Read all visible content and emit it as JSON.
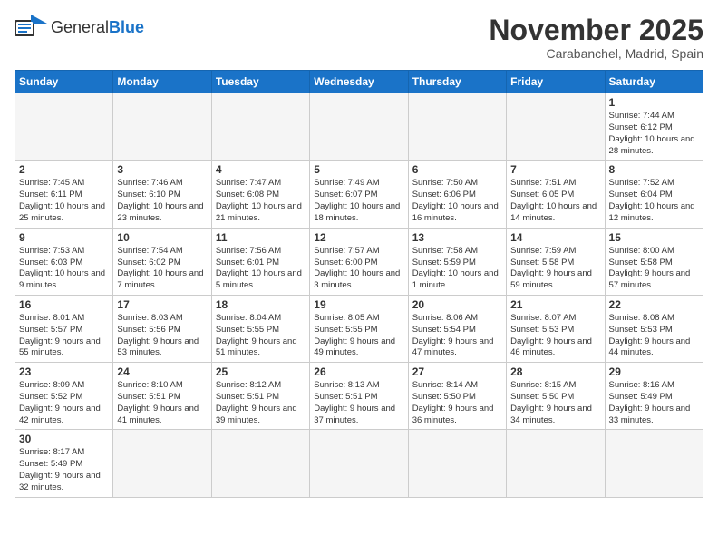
{
  "header": {
    "logo_general": "General",
    "logo_blue": "Blue",
    "month_title": "November 2025",
    "location": "Carabanchel, Madrid, Spain"
  },
  "days_of_week": [
    "Sunday",
    "Monday",
    "Tuesday",
    "Wednesday",
    "Thursday",
    "Friday",
    "Saturday"
  ],
  "weeks": [
    [
      {
        "day": "",
        "info": ""
      },
      {
        "day": "",
        "info": ""
      },
      {
        "day": "",
        "info": ""
      },
      {
        "day": "",
        "info": ""
      },
      {
        "day": "",
        "info": ""
      },
      {
        "day": "",
        "info": ""
      },
      {
        "day": "1",
        "info": "Sunrise: 7:44 AM\nSunset: 6:12 PM\nDaylight: 10 hours and 28 minutes."
      }
    ],
    [
      {
        "day": "2",
        "info": "Sunrise: 7:45 AM\nSunset: 6:11 PM\nDaylight: 10 hours and 25 minutes."
      },
      {
        "day": "3",
        "info": "Sunrise: 7:46 AM\nSunset: 6:10 PM\nDaylight: 10 hours and 23 minutes."
      },
      {
        "day": "4",
        "info": "Sunrise: 7:47 AM\nSunset: 6:08 PM\nDaylight: 10 hours and 21 minutes."
      },
      {
        "day": "5",
        "info": "Sunrise: 7:49 AM\nSunset: 6:07 PM\nDaylight: 10 hours and 18 minutes."
      },
      {
        "day": "6",
        "info": "Sunrise: 7:50 AM\nSunset: 6:06 PM\nDaylight: 10 hours and 16 minutes."
      },
      {
        "day": "7",
        "info": "Sunrise: 7:51 AM\nSunset: 6:05 PM\nDaylight: 10 hours and 14 minutes."
      },
      {
        "day": "8",
        "info": "Sunrise: 7:52 AM\nSunset: 6:04 PM\nDaylight: 10 hours and 12 minutes."
      }
    ],
    [
      {
        "day": "9",
        "info": "Sunrise: 7:53 AM\nSunset: 6:03 PM\nDaylight: 10 hours and 9 minutes."
      },
      {
        "day": "10",
        "info": "Sunrise: 7:54 AM\nSunset: 6:02 PM\nDaylight: 10 hours and 7 minutes."
      },
      {
        "day": "11",
        "info": "Sunrise: 7:56 AM\nSunset: 6:01 PM\nDaylight: 10 hours and 5 minutes."
      },
      {
        "day": "12",
        "info": "Sunrise: 7:57 AM\nSunset: 6:00 PM\nDaylight: 10 hours and 3 minutes."
      },
      {
        "day": "13",
        "info": "Sunrise: 7:58 AM\nSunset: 5:59 PM\nDaylight: 10 hours and 1 minute."
      },
      {
        "day": "14",
        "info": "Sunrise: 7:59 AM\nSunset: 5:58 PM\nDaylight: 9 hours and 59 minutes."
      },
      {
        "day": "15",
        "info": "Sunrise: 8:00 AM\nSunset: 5:58 PM\nDaylight: 9 hours and 57 minutes."
      }
    ],
    [
      {
        "day": "16",
        "info": "Sunrise: 8:01 AM\nSunset: 5:57 PM\nDaylight: 9 hours and 55 minutes."
      },
      {
        "day": "17",
        "info": "Sunrise: 8:03 AM\nSunset: 5:56 PM\nDaylight: 9 hours and 53 minutes."
      },
      {
        "day": "18",
        "info": "Sunrise: 8:04 AM\nSunset: 5:55 PM\nDaylight: 9 hours and 51 minutes."
      },
      {
        "day": "19",
        "info": "Sunrise: 8:05 AM\nSunset: 5:55 PM\nDaylight: 9 hours and 49 minutes."
      },
      {
        "day": "20",
        "info": "Sunrise: 8:06 AM\nSunset: 5:54 PM\nDaylight: 9 hours and 47 minutes."
      },
      {
        "day": "21",
        "info": "Sunrise: 8:07 AM\nSunset: 5:53 PM\nDaylight: 9 hours and 46 minutes."
      },
      {
        "day": "22",
        "info": "Sunrise: 8:08 AM\nSunset: 5:53 PM\nDaylight: 9 hours and 44 minutes."
      }
    ],
    [
      {
        "day": "23",
        "info": "Sunrise: 8:09 AM\nSunset: 5:52 PM\nDaylight: 9 hours and 42 minutes."
      },
      {
        "day": "24",
        "info": "Sunrise: 8:10 AM\nSunset: 5:51 PM\nDaylight: 9 hours and 41 minutes."
      },
      {
        "day": "25",
        "info": "Sunrise: 8:12 AM\nSunset: 5:51 PM\nDaylight: 9 hours and 39 minutes."
      },
      {
        "day": "26",
        "info": "Sunrise: 8:13 AM\nSunset: 5:51 PM\nDaylight: 9 hours and 37 minutes."
      },
      {
        "day": "27",
        "info": "Sunrise: 8:14 AM\nSunset: 5:50 PM\nDaylight: 9 hours and 36 minutes."
      },
      {
        "day": "28",
        "info": "Sunrise: 8:15 AM\nSunset: 5:50 PM\nDaylight: 9 hours and 34 minutes."
      },
      {
        "day": "29",
        "info": "Sunrise: 8:16 AM\nSunset: 5:49 PM\nDaylight: 9 hours and 33 minutes."
      }
    ],
    [
      {
        "day": "30",
        "info": "Sunrise: 8:17 AM\nSunset: 5:49 PM\nDaylight: 9 hours and 32 minutes."
      },
      {
        "day": "",
        "info": ""
      },
      {
        "day": "",
        "info": ""
      },
      {
        "day": "",
        "info": ""
      },
      {
        "day": "",
        "info": ""
      },
      {
        "day": "",
        "info": ""
      },
      {
        "day": "",
        "info": ""
      }
    ]
  ]
}
